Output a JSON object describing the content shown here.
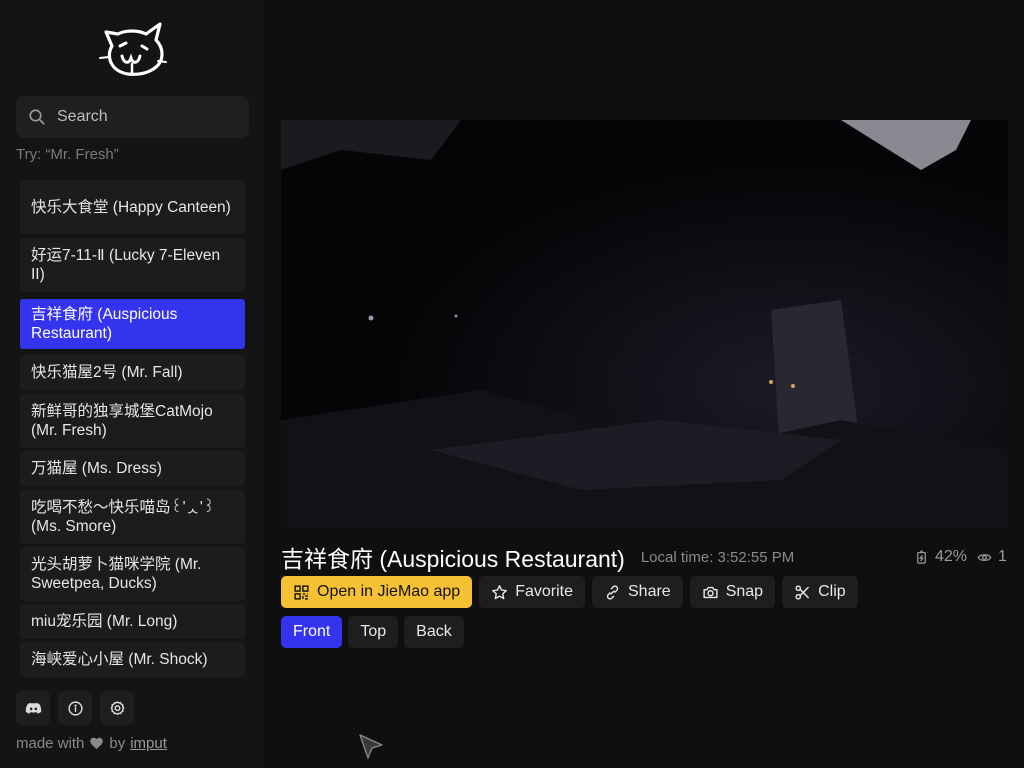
{
  "sidebar": {
    "search": {
      "placeholder": "Search"
    },
    "hint": "Try: “Mr. Fresh”",
    "items": [
      {
        "label": "快乐大食堂 (Happy Canteen)",
        "active": false
      },
      {
        "label": "好运7-11-Ⅱ (Lucky 7-Eleven II)",
        "active": false
      },
      {
        "label": "吉祥食府 (Auspicious Restaurant)",
        "active": true
      },
      {
        "label": "快乐猫屋2号 (Mr. Fall)",
        "active": false
      },
      {
        "label": "新鲜哥的独享城堡CatMojo (Mr. Fresh)",
        "active": false
      },
      {
        "label": "万猫屋 (Ms. Dress)",
        "active": false
      },
      {
        "label": "吃喝不愁～快乐喵岛꒰'ᆺ'꒱ (Ms. Smore)",
        "active": false
      },
      {
        "label": "光头胡萝卜猫咪学院 (Mr. Sweetpea, Ducks)",
        "active": false
      },
      {
        "label": "miu宠乐园 (Mr. Long)",
        "active": false
      },
      {
        "label": "海峡爱心小屋 (Mr. Shock)",
        "active": false
      }
    ],
    "bottom_icons": [
      "discord-icon",
      "info-icon",
      "settings-icon"
    ],
    "footer": {
      "prefix": "made with",
      "by": "by",
      "link": "imput"
    }
  },
  "camera": {
    "title": "吉祥食府 (Auspicious Restaurant)",
    "local_time": "Local time: 3:52:55 PM",
    "battery": "42%",
    "viewers": "1"
  },
  "actions": {
    "open_app": "Open in JieMao app",
    "favorite": "Favorite",
    "share": "Share",
    "snap": "Snap",
    "clip": "Clip"
  },
  "views": [
    {
      "label": "Front",
      "active": true
    },
    {
      "label": "Top",
      "active": false
    },
    {
      "label": "Back",
      "active": false
    }
  ],
  "colors": {
    "accent": "#3434ef",
    "app_button": "#f6c233",
    "background": "#0f0f0f",
    "sidebar": "#141414"
  }
}
